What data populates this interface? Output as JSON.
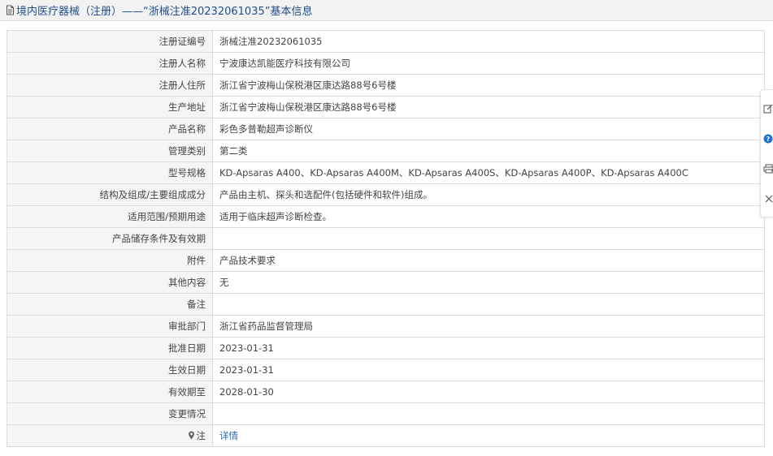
{
  "header": {
    "title": "境内医疗器械（注册）——“浙械注准20232061035”基本信息"
  },
  "rows": [
    {
      "label": "注册证编号",
      "value": "浙械注准20232061035"
    },
    {
      "label": "注册人名称",
      "value": "宁波康达凯能医疗科技有限公司"
    },
    {
      "label": "注册人住所",
      "value": "浙江省宁波梅山保税港区康达路88号6号楼"
    },
    {
      "label": "生产地址",
      "value": "浙江省宁波梅山保税港区康达路88号6号楼"
    },
    {
      "label": "产品名称",
      "value": "彩色多普勒超声诊断仪"
    },
    {
      "label": "管理类别",
      "value": "第二类"
    },
    {
      "label": "型号规格",
      "value": "KD-Apsaras A400、KD-Apsaras A400M、KD-Apsaras A400S、KD-Apsaras A400P、KD-Apsaras A400C"
    },
    {
      "label": "结构及组成/主要组成成分",
      "value": "产品由主机、探头和选配件(包括硬件和软件)组成。"
    },
    {
      "label": "适用范围/预期用途",
      "value": "适用于临床超声诊断检查。"
    },
    {
      "label": "产品储存条件及有效期",
      "value": ""
    },
    {
      "label": "附件",
      "value": "产品技术要求"
    },
    {
      "label": "其他内容",
      "value": "无"
    },
    {
      "label": "备注",
      "value": ""
    },
    {
      "label": "审批部门",
      "value": "浙江省药品监督管理局"
    },
    {
      "label": "批准日期",
      "value": "2023-01-31"
    },
    {
      "label": "生效日期",
      "value": "2023-01-31"
    },
    {
      "label": "有效期至",
      "value": "2028-01-30"
    },
    {
      "label": "变更情况",
      "value": ""
    }
  ],
  "note_row": {
    "label": "注",
    "link": "详情"
  },
  "icons": {
    "title": "document-icon",
    "note": "pin-icon",
    "side": [
      "edit-icon",
      "help-icon",
      "print-icon",
      "close-icon"
    ]
  },
  "colors": {
    "title_text": "#1f4f8b",
    "link": "#2a6bb5",
    "label_bg": "#f5f5f5",
    "border": "#dcdcdc",
    "help_icon": "#1e6fd0"
  }
}
